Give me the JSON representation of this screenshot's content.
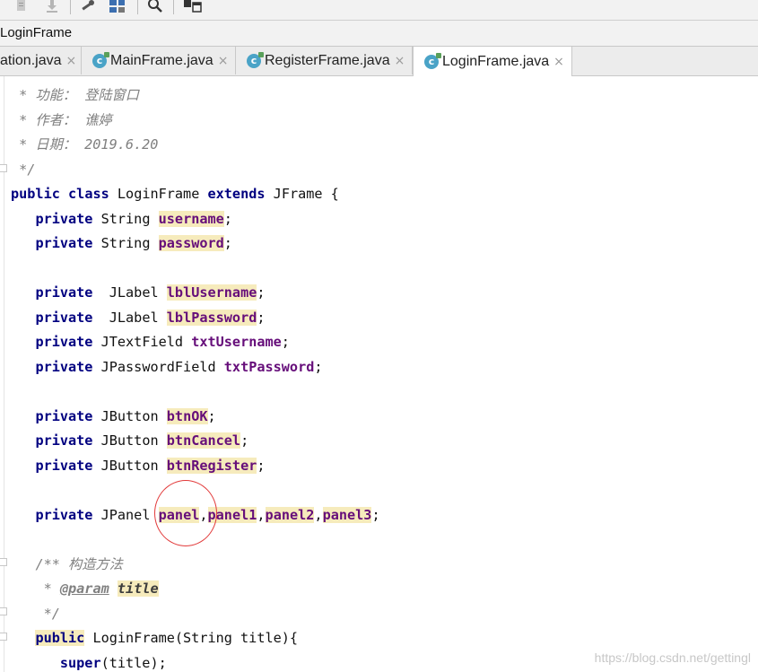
{
  "toolbar": {
    "icons": [
      "document-icon",
      "download-icon",
      "wrench-icon",
      "project-structure-icon",
      "search-icon",
      "window-icon"
    ]
  },
  "breadcrumb": {
    "label": "LoginFrame"
  },
  "tabs": [
    {
      "label": "ation.java",
      "close": "×",
      "active": false,
      "has_icon": false
    },
    {
      "label": "MainFrame.java",
      "close": "×",
      "active": false,
      "has_icon": true,
      "icon_letter": "c"
    },
    {
      "label": "RegisterFrame.java",
      "close": "×",
      "active": false,
      "has_icon": true,
      "icon_letter": "c"
    },
    {
      "label": "LoginFrame.java",
      "close": "×",
      "active": true,
      "has_icon": true,
      "icon_letter": "c"
    }
  ],
  "code": {
    "c1": " * 功能： 登陆窗口",
    "c2": " * 作者： 谯婷",
    "c3": " * 日期： 2019.6.20",
    "c4": " */",
    "class_public": "public",
    "class_kw": "class",
    "class_name": "LoginFrame",
    "class_extends": "extends",
    "class_super": "JFrame {",
    "kw_private": "private",
    "type_string": "String",
    "f_username": "username",
    "f_password": "password",
    "type_jlabel": " JLabel",
    "f_lblUsername": "lblUsername",
    "f_lblPassword": "lblPassword",
    "type_jtextfield": "JTextField",
    "f_txtUsername": "txtUsername",
    "type_jpasswordfield": "JPasswordField",
    "f_txtPassword": "txtPassword",
    "type_jbutton": "JButton",
    "f_btnOK": "btnOK",
    "f_btnCancel": "btnCancel",
    "f_btnRegister": "btnRegister",
    "type_jpanel": "JPanel",
    "f_panel": "panel",
    "f_panel1": "panel1",
    "f_panel2": "panel2",
    "f_panel3": "panel3",
    "semi": ";",
    "comma": ",",
    "doc_open": "/** 构造方法",
    "doc_star": " * ",
    "doc_tag": "@param",
    "doc_param": "title",
    "doc_close": " */",
    "ctor_public": "public",
    "ctor_sig": " LoginFrame(String title){",
    "super_kw": "super",
    "super_args": "(title);"
  },
  "watermark": "https://blog.csdn.net/gettingl"
}
